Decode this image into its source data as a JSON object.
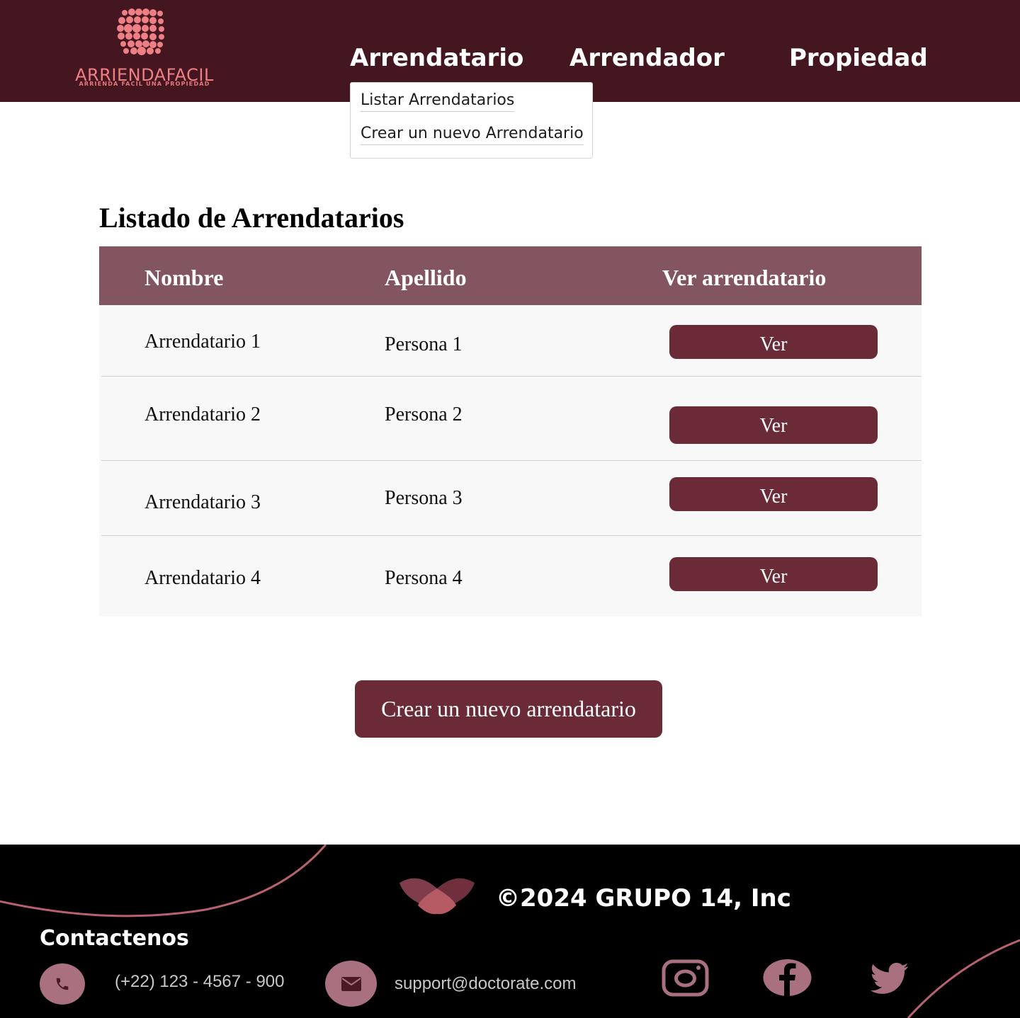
{
  "brand": {
    "name": "ARRIENDAFACIL",
    "tagline": "ARRIENDA FACIL UNA PROPIEDAD"
  },
  "nav": {
    "items": [
      {
        "label": "Arrendatario"
      },
      {
        "label": "Arrendador"
      },
      {
        "label": "Propiedad"
      }
    ],
    "dropdown": [
      {
        "label": "Listar Arrendatarios"
      },
      {
        "label": "Crear un nuevo Arrendatario"
      }
    ]
  },
  "main": {
    "title": "Listado de Arrendatarios",
    "table": {
      "headers": [
        "Nombre",
        "Apellido",
        "Ver arrendatario"
      ],
      "rows": [
        {
          "nombre": "Arrendatario 1",
          "apellido": "Persona 1",
          "action": "Ver"
        },
        {
          "nombre": "Arrendatario 2",
          "apellido": "Persona 2",
          "action": "Ver"
        },
        {
          "nombre": "Arrendatario 3",
          "apellido": "Persona 3",
          "action": "Ver"
        },
        {
          "nombre": "Arrendatario 4",
          "apellido": "Persona 4",
          "action": "Ver"
        }
      ]
    },
    "create_button": "Crear un nuevo arrendatario"
  },
  "footer": {
    "copyright": "©2024 GRUPO 14, Inc",
    "contact_title": "Contactenos",
    "phone": "(+22) 123 - 4567 - 900",
    "email": "support@doctorate.com",
    "social_icons": [
      "instagram-icon",
      "facebook-icon",
      "twitter-icon"
    ]
  },
  "colors": {
    "header_bg": "#431620",
    "table_header_bg": "#835560",
    "button_bg": "#6a2b37",
    "footer_bg": "#000000",
    "accent_pink": "#ee7f85",
    "icon_circle": "#a9707f"
  }
}
